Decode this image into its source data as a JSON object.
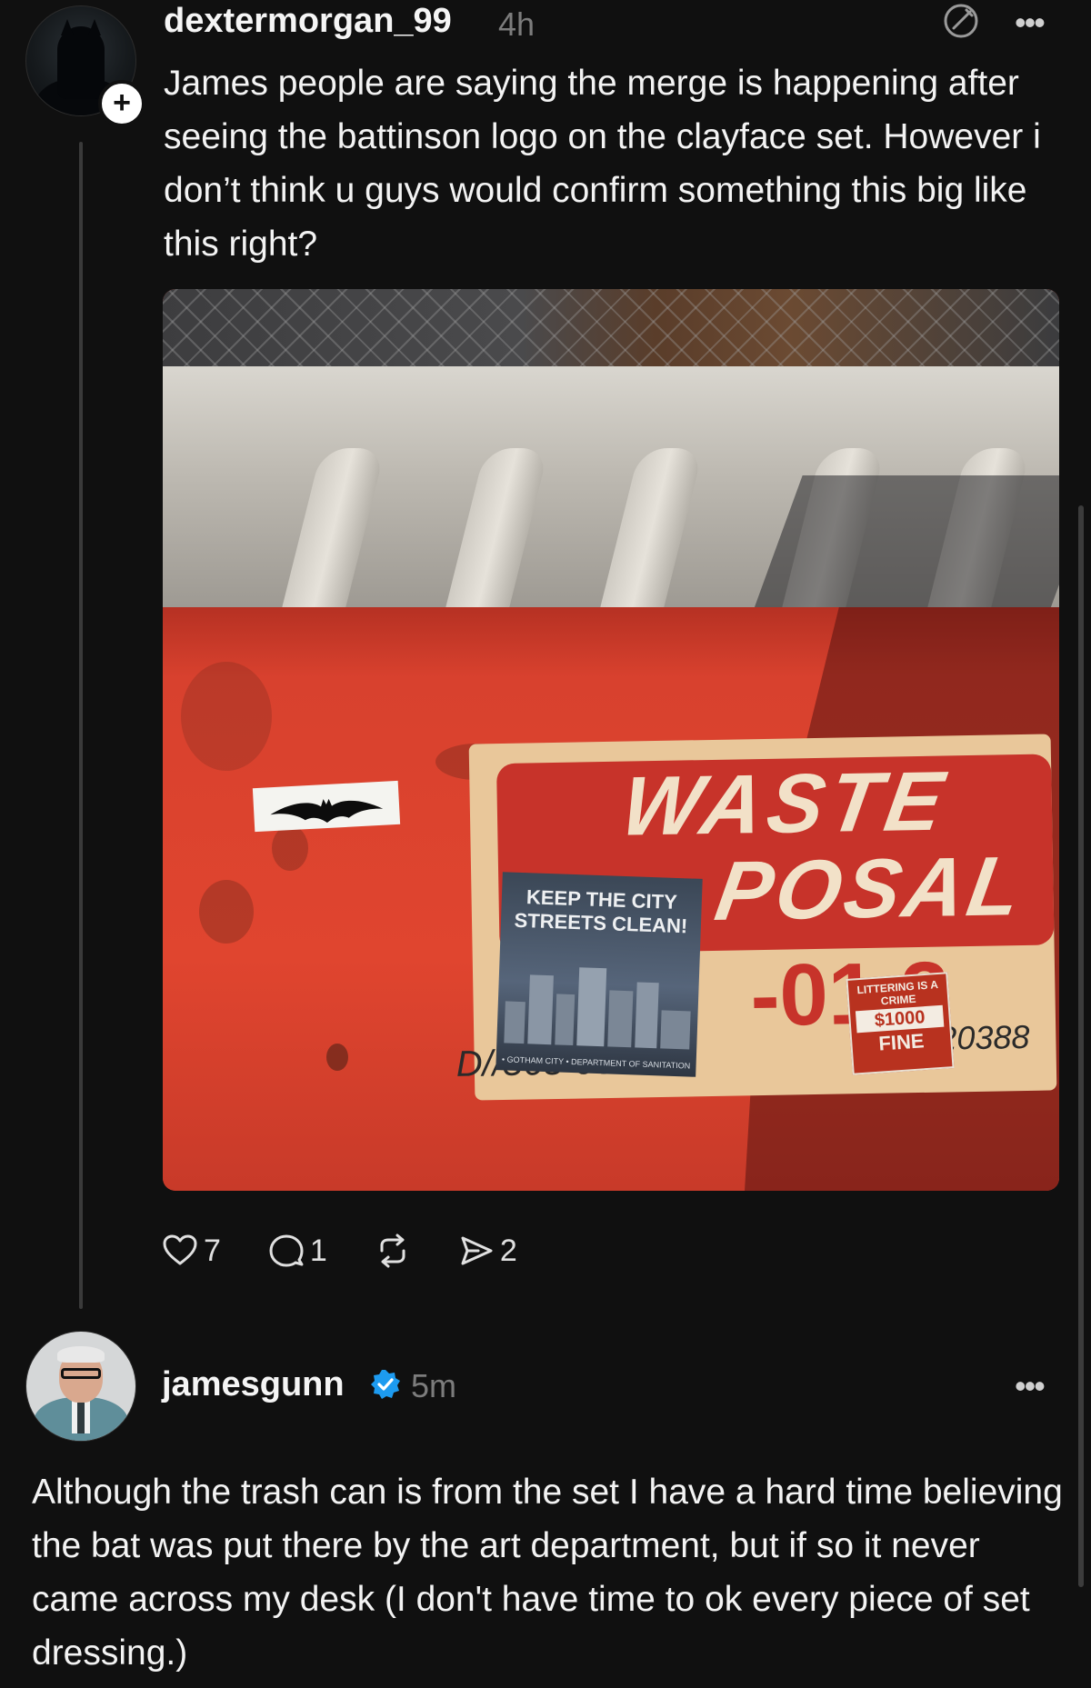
{
  "post": {
    "username": "dextermorgan_99",
    "time": "4h",
    "text": "James people are saying the merge is happening after seeing the battinson logo on the clayface set. However i don’t think u guys would confirm something this big like this right?",
    "image": {
      "waste_line1": "WASTE",
      "waste_line2": "POSAL",
      "number_fragment": "-01 3",
      "sticker_keep": "KEEP THE CITY STREETS CLEAN!",
      "sticker_keep_footer": "• GOTHAM CITY • DEPARTMENT OF SANITATION",
      "litter_line1": "LITTERING IS A CRIME",
      "litter_amount": "$1000",
      "litter_fine": "FINE",
      "code_left": "D//565-990",
      "code_right": "No 20388"
    },
    "actions": {
      "likes": "7",
      "replies": "1",
      "shares": "2"
    }
  },
  "reply": {
    "username": "jamesgunn",
    "time": "5m",
    "text": "Although the trash can is from the set I have a hard time believing the bat was put there by the art department, but if so it never came across my desk (I don't have time to ok every piece of set dressing.)"
  },
  "colors": {
    "background": "#101010",
    "verified": "#1d9bf0",
    "muted": "#7c7c7c"
  },
  "icons": [
    "plus-icon",
    "edit-icon",
    "more-icon",
    "heart-icon",
    "comment-icon",
    "repost-icon",
    "share-icon",
    "verified-icon"
  ]
}
